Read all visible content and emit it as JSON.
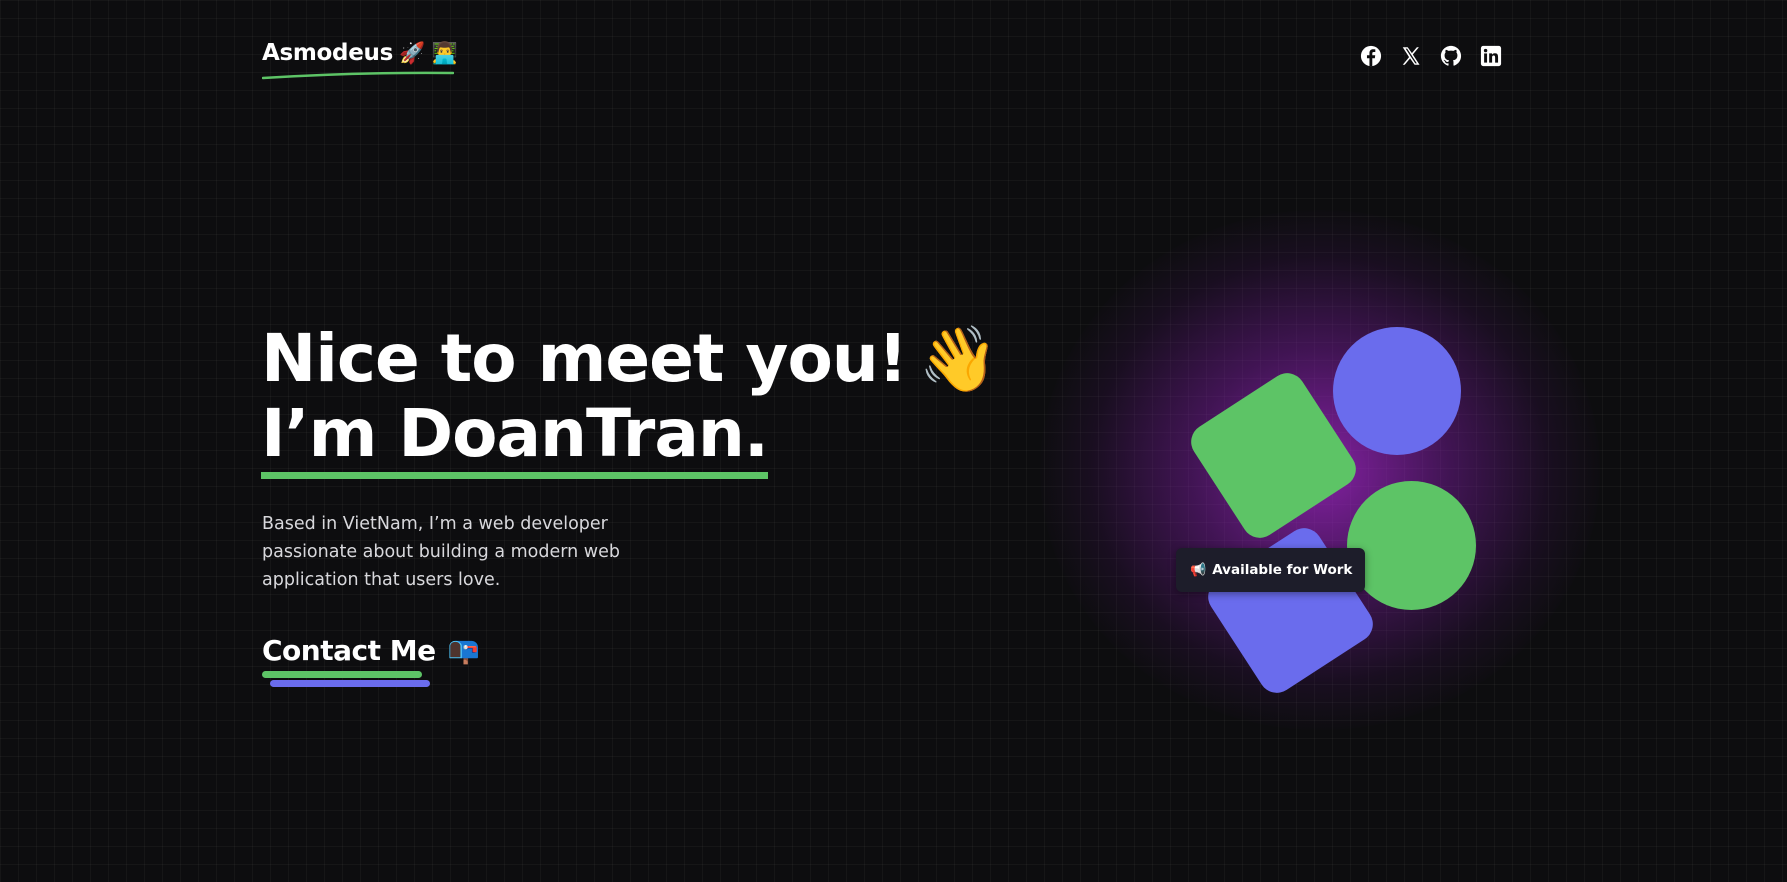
{
  "header": {
    "logo": {
      "text": "Asmodeus",
      "emojis": "🚀 👨‍💻"
    },
    "socials": [
      {
        "name": "facebook-icon",
        "label": "Facebook"
      },
      {
        "name": "x-icon",
        "label": "X"
      },
      {
        "name": "github-icon",
        "label": "GitHub"
      },
      {
        "name": "linkedin-icon",
        "label": "LinkedIn"
      }
    ]
  },
  "hero": {
    "greeting": "Nice to meet you!",
    "wave_emoji": "👋",
    "name_line": "I’m DoanTran.",
    "intro": "Based in VietNam, I’m a web developer passionate about building a modern web application that users love.",
    "contact": {
      "label": "Contact Me",
      "emoji": "📭"
    }
  },
  "badge": {
    "icon": "📢",
    "label": "Available for Work"
  },
  "colors": {
    "background": "#0d0d0f",
    "accent_green": "#5dc466",
    "accent_purple": "#6a6ced",
    "glow": "#aa28d2",
    "badge_bg": "#1d1d2a"
  }
}
